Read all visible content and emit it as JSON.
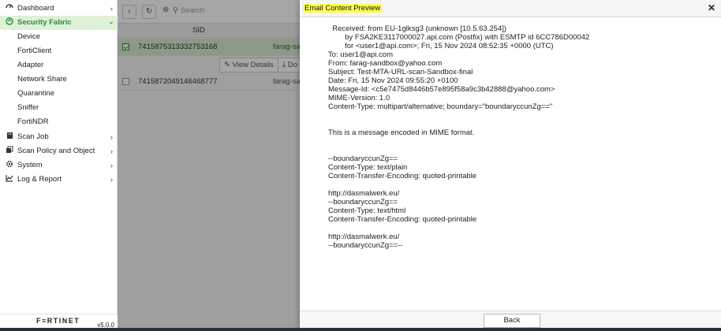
{
  "sidebar": {
    "items": [
      {
        "label": "Dashboard",
        "icon": "dashboard-icon"
      },
      {
        "label": "Security Fabric",
        "icon": "security-fabric-icon",
        "active": true
      },
      {
        "label": "Device"
      },
      {
        "label": "FortiClient"
      },
      {
        "label": "Adapter"
      },
      {
        "label": "Network Share"
      },
      {
        "label": "Quarantine"
      },
      {
        "label": "Sniffer"
      },
      {
        "label": "FortiNDR"
      },
      {
        "label": "Scan Job",
        "icon": "scan-job-icon"
      },
      {
        "label": "Scan Policy and Object",
        "icon": "scan-policy-icon"
      },
      {
        "label": "System",
        "icon": "gear-icon"
      },
      {
        "label": "Log & Report",
        "icon": "log-report-icon"
      }
    ],
    "logo": "F≡RTINET",
    "version": "v5.0.0"
  },
  "main": {
    "search_placeholder": "Search",
    "column_sid": "SID",
    "rows": [
      {
        "sid": "7415875313332753168",
        "user": "farag-sand",
        "selected": true
      },
      {
        "sid": "7415872049146468777",
        "user": "farag-san",
        "selected": false
      }
    ],
    "view_details_label": "View Details",
    "download_label": "Do"
  },
  "modal": {
    "title": "Email Content Preview",
    "lines": [
      "  Received: from EU-1glksg3 (unknown [10.5.63.254])",
      "        by FSA2KE3117000027.api.com (Postfix) with ESMTP id 6CC786D00042",
      "        for <user1@api.com>; Fri, 15 Nov 2024 08:52:35 +0000 (UTC)",
      "To: user1@api.com",
      "From: farag-sandbox@yahoo.com",
      "Subject: Test-MTA-URL-scan-Sandbox-final",
      "Date: Fri, 15 Nov 2024 09:55:20 +0100",
      "Message-Id: <c5e7475d8446b57e895f58a9c3b42888@yahoo.com>",
      "MIME-Version: 1.0",
      "Content-Type: multipart/alternative; boundary=\"boundaryccunZg==\"",
      "",
      "",
      "This is a message encoded in MIME format.",
      "",
      "",
      "--boundaryccunZg==",
      "Content-Type: text/plain",
      "Content-Transfer-Encoding: quoted-printable",
      "",
      "http://dasmalwerk.eu/",
      "--boundaryccunZg==",
      "Content-Type: text/html",
      "Content-Transfer-Encoding: quoted-printable",
      "",
      "http://dasmalwerk.eu/",
      "--boundaryccunZg==--"
    ],
    "back_label": "Back"
  },
  "colors": {
    "accent": "#2e8b3a",
    "title_highlight": "#ffff4d"
  }
}
